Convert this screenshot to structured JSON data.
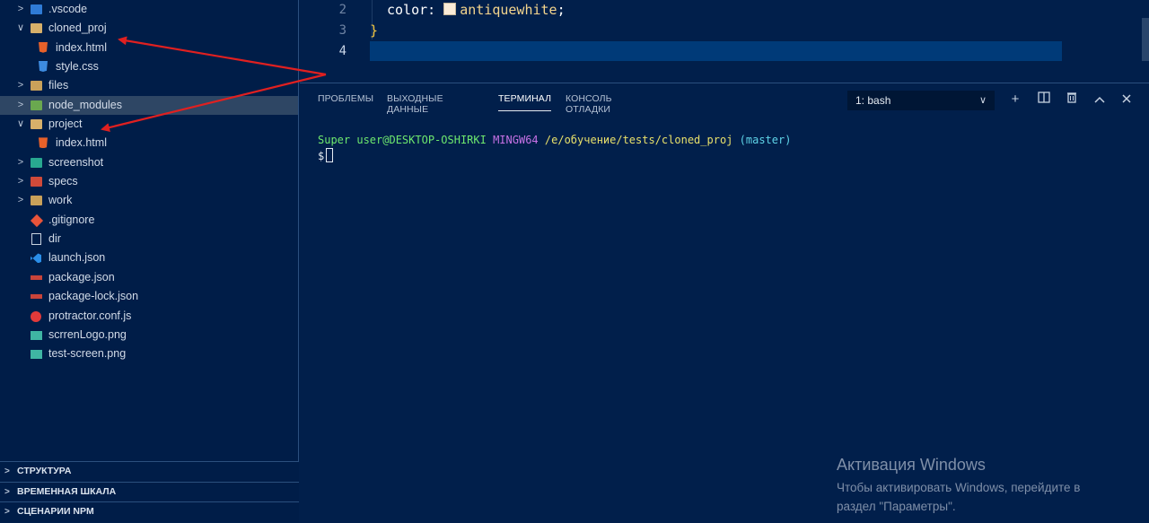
{
  "explorer": {
    "items": [
      {
        "label": ".vscode",
        "kind": "folder",
        "icon": "vscode-folder-icon",
        "expanded": false,
        "depth": 0
      },
      {
        "label": "cloned_proj",
        "kind": "folder",
        "icon": "folder-open-icon",
        "expanded": true,
        "depth": 0
      },
      {
        "label": "index.html",
        "kind": "file",
        "icon": "html5-icon",
        "depth": 1
      },
      {
        "label": "style.css",
        "kind": "file",
        "icon": "css3-icon",
        "depth": 1
      },
      {
        "label": "files",
        "kind": "folder",
        "icon": "folder-icon",
        "expanded": false,
        "depth": 0
      },
      {
        "label": "node_modules",
        "kind": "folder",
        "icon": "node-folder-icon",
        "expanded": false,
        "depth": 0,
        "selected": true
      },
      {
        "label": "project",
        "kind": "folder",
        "icon": "folder-open-icon",
        "expanded": true,
        "depth": 0
      },
      {
        "label": "index.html",
        "kind": "file",
        "icon": "html5-icon",
        "depth": 1
      },
      {
        "label": "screenshot",
        "kind": "folder",
        "icon": "screenshot-folder-icon",
        "expanded": false,
        "depth": 0
      },
      {
        "label": "specs",
        "kind": "folder",
        "icon": "specs-folder-icon",
        "expanded": false,
        "depth": 0
      },
      {
        "label": "work",
        "kind": "folder",
        "icon": "folder-icon",
        "expanded": false,
        "depth": 0
      },
      {
        "label": ".gitignore",
        "kind": "file",
        "icon": "git-icon",
        "depth": 0
      },
      {
        "label": "dir",
        "kind": "file",
        "icon": "file-icon",
        "depth": 0
      },
      {
        "label": "launch.json",
        "kind": "file",
        "icon": "vscode-icon",
        "depth": 0
      },
      {
        "label": "package.json",
        "kind": "file",
        "icon": "npm-icon",
        "depth": 0
      },
      {
        "label": "package-lock.json",
        "kind": "file",
        "icon": "npm-icon",
        "depth": 0
      },
      {
        "label": "protractor.conf.js",
        "kind": "file",
        "icon": "protractor-icon",
        "depth": 0
      },
      {
        "label": "scrrenLogo.png",
        "kind": "file",
        "icon": "image-icon",
        "depth": 0
      },
      {
        "label": "test-screen.png",
        "kind": "file",
        "icon": "image-icon",
        "depth": 0
      }
    ]
  },
  "bottom_panels": [
    "СТРУКТУРА",
    "ВРЕМЕННАЯ ШКАЛА",
    "СЦЕНАРИИ NPM"
  ],
  "editor": {
    "line_numbers": [
      "2",
      "3",
      "4"
    ],
    "line2_property": "color: ",
    "line2_value": "antiquewhite",
    "line2_end": ";",
    "line3": "}"
  },
  "panel": {
    "tabs": [
      "ПРОБЛЕМЫ",
      "ВЫХОДНЫЕ ДАННЫЕ",
      "ТЕРМИНАЛ",
      "КОНСОЛЬ ОТЛАДКИ"
    ],
    "active_tab": "ТЕРМИНАЛ",
    "terminal_select": "1: bash"
  },
  "terminal": {
    "user": "Super user@DESKTOP-OSHIRKI",
    "system": "MINGW64",
    "path": "/e/обучение/tests/cloned_proj",
    "branch": "(master)",
    "prompt": "$"
  },
  "watermark": {
    "title": "Активация Windows",
    "line1": "Чтобы активировать Windows, перейдите в",
    "line2": "раздел \"Параметры\"."
  },
  "colors": {
    "background": "#011f4b",
    "sidebar": "#001d48",
    "selected_row": "#2e4664",
    "current_line": "#003a78",
    "arrow": "#e02020"
  }
}
